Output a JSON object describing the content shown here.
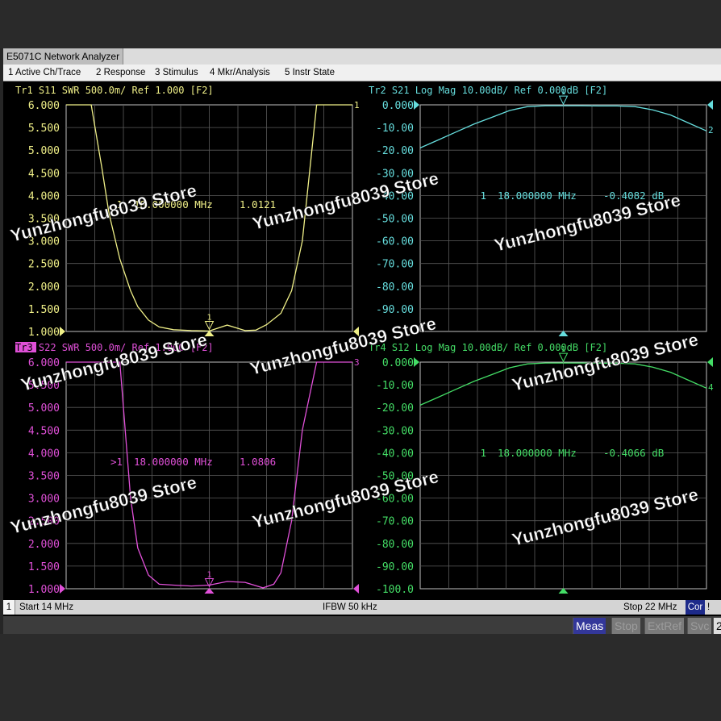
{
  "window": {
    "title": "E5071C Network Analyzer"
  },
  "menu": [
    "1 Active Ch/Trace",
    "2 Response",
    "3 Stimulus",
    "4 Mkr/Analysis",
    "5 Instr State"
  ],
  "traces": [
    {
      "header": "Tr1 S11 SWR 500.0m/ Ref 1.000 [F2]",
      "color": "#f0f088",
      "yticks": [
        "6.000",
        "5.500",
        "5.000",
        "4.500",
        "4.000",
        "3.500",
        "3.000",
        "2.500",
        "2.000",
        "1.500",
        "1.000"
      ],
      "marker": {
        "label": "1",
        "readout_index": "1",
        "freq": "18.000000 MHz",
        "value": "1.0121"
      },
      "trace_number": "1"
    },
    {
      "header": "Tr2 S21 Log Mag 10.00dB/ Ref 0.000dB [F2]",
      "color": "#66dddd",
      "yticks": [
        "0.000",
        "-10.00",
        "-20.00",
        "-30.00",
        "-40.00",
        "-50.00",
        "-60.00",
        "-70.00",
        "-80.00",
        "-90.00"
      ],
      "marker": {
        "label": "1",
        "readout_index": "1",
        "freq": "18.000000 MHz",
        "value": "-0.4082 dB"
      },
      "trace_number": "2"
    },
    {
      "header": "Tr3 S22 SWR 500.0m/ Ref 1.000 [F2]",
      "header_tag": "Tr3",
      "header_rest": " S22 SWR 500.0m/ Ref 1.000 [F2]",
      "color": "#e050d8",
      "yticks": [
        "6.000",
        "5.500",
        "5.000",
        "4.500",
        "4.000",
        "3.500",
        "3.000",
        "2.500",
        "2.000",
        "1.500",
        "1.000"
      ],
      "marker": {
        "label": "1",
        "readout_index": ">1",
        "freq": "18.000000 MHz",
        "value": "1.0806"
      },
      "trace_number": "3"
    },
    {
      "header": "Tr4 S12 Log Mag 10.00dB/ Ref 0.000dB [F2]",
      "color": "#44dd66",
      "yticks": [
        "0.000",
        "-10.00",
        "-20.00",
        "-30.00",
        "-40.00",
        "-50.00",
        "-60.00",
        "-70.00",
        "-80.00",
        "-90.00",
        "-100.0"
      ],
      "marker": {
        "label": "1",
        "readout_index": "1",
        "freq": "18.000000 MHz",
        "value": "-0.4066 dB"
      },
      "trace_number": "4"
    }
  ],
  "status": {
    "channel": "1",
    "start": "Start 14 MHz",
    "ifbw": "IFBW 50 kHz",
    "stop": "Stop 22 MHz",
    "cor": "Cor",
    "alert": "!"
  },
  "softkeys": [
    "Meas",
    "Stop",
    "ExtRef",
    "Svc",
    "2"
  ],
  "watermark": "Yunzhongfu8039 Store",
  "chart_data": [
    {
      "type": "line",
      "title": "Tr1 S11 SWR",
      "xlabel": "",
      "ylabel": "",
      "xlim": [
        14,
        22
      ],
      "ylim": [
        1.0,
        6.0
      ],
      "grid": true,
      "series": [
        {
          "name": "S11",
          "x": [
            14,
            14.7,
            15,
            15.2,
            15.5,
            15.8,
            16,
            16.3,
            16.6,
            17,
            17.5,
            18,
            18.5,
            19,
            19.3,
            19.6,
            20,
            20.3,
            20.6,
            21,
            22
          ],
          "values": [
            6.0,
            6.0,
            4.6,
            3.6,
            2.6,
            1.9,
            1.55,
            1.25,
            1.1,
            1.04,
            1.02,
            1.01,
            1.14,
            1.02,
            1.03,
            1.15,
            1.4,
            1.9,
            3.0,
            6.0,
            6.0
          ]
        }
      ]
    },
    {
      "type": "line",
      "title": "Tr2 S21 Log Mag",
      "xlabel": "",
      "ylabel": "",
      "xlim": [
        14,
        22
      ],
      "ylim": [
        -100,
        0
      ],
      "grid": true,
      "series": [
        {
          "name": "S21",
          "x": [
            14,
            14.5,
            15,
            15.5,
            16,
            16.5,
            17,
            17.5,
            18,
            18.5,
            19,
            19.5,
            20,
            20.5,
            21,
            21.5,
            22
          ],
          "values": [
            -19,
            -15.5,
            -12,
            -8.5,
            -5.5,
            -2.5,
            -0.8,
            -0.4,
            -0.4,
            -0.4,
            -0.5,
            -0.5,
            -0.8,
            -2.2,
            -4.5,
            -8,
            -11.5
          ]
        }
      ]
    },
    {
      "type": "line",
      "title": "Tr3 S22 SWR",
      "xlabel": "",
      "ylabel": "",
      "xlim": [
        14,
        22
      ],
      "ylim": [
        1.0,
        6.0
      ],
      "grid": true,
      "series": [
        {
          "name": "S22",
          "x": [
            14,
            15,
            15.5,
            15.8,
            16,
            16.3,
            16.6,
            17,
            17.5,
            18,
            18.5,
            19,
            19.5,
            19.8,
            20,
            20.3,
            20.6,
            21,
            21.3,
            22
          ],
          "values": [
            6.0,
            6.0,
            6.0,
            3.0,
            1.9,
            1.3,
            1.1,
            1.08,
            1.06,
            1.08,
            1.16,
            1.14,
            1.02,
            1.1,
            1.35,
            2.5,
            4.5,
            6.0,
            6.0,
            6.0
          ]
        }
      ]
    },
    {
      "type": "line",
      "title": "Tr4 S12 Log Mag",
      "xlabel": "",
      "ylabel": "",
      "xlim": [
        14,
        22
      ],
      "ylim": [
        -100,
        0
      ],
      "grid": true,
      "series": [
        {
          "name": "S12",
          "x": [
            14,
            14.5,
            15,
            15.5,
            16,
            16.5,
            17,
            17.5,
            18,
            18.5,
            19,
            19.5,
            20,
            20.5,
            21,
            21.5,
            22
          ],
          "values": [
            -19,
            -15.5,
            -12,
            -8.5,
            -5.5,
            -2.5,
            -0.8,
            -0.4,
            -0.4,
            -0.4,
            -0.5,
            -0.5,
            -0.8,
            -2.2,
            -4.5,
            -8,
            -11.5
          ]
        }
      ]
    }
  ]
}
